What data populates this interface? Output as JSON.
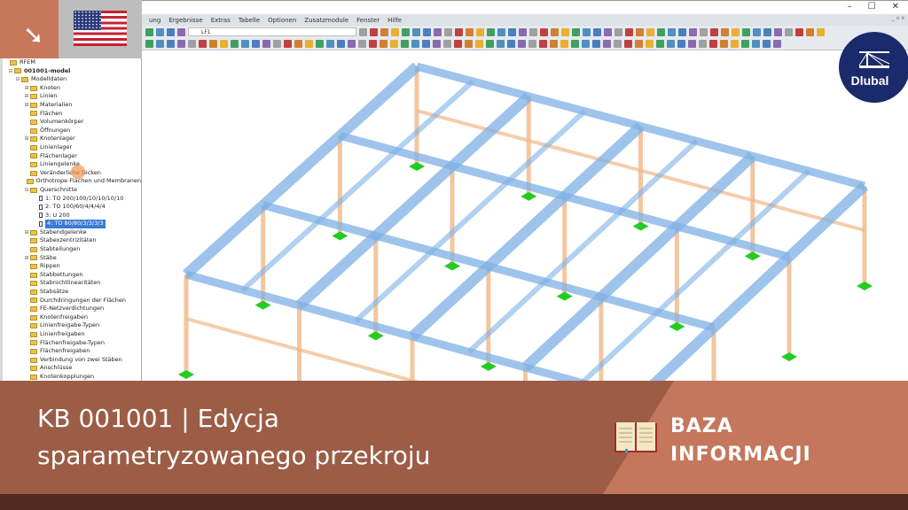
{
  "window": {
    "minimize": "–",
    "maximize": "☐",
    "close": "✕"
  },
  "menu": [
    "ung",
    "Ergebnisse",
    "Extras",
    "Tabelle",
    "Optionen",
    "Zusatzmodule",
    "Fenster",
    "Hilfe"
  ],
  "toolbar": {
    "load_case": "LF1"
  },
  "tree": {
    "root": "RFEM",
    "model": "001001-model",
    "group": "Modelldaten",
    "items": [
      {
        "label": "Knoten",
        "exp": true
      },
      {
        "label": "Linien",
        "exp": true
      },
      {
        "label": "Materialien",
        "exp": true
      },
      {
        "label": "Flächen"
      },
      {
        "label": "Volumenkörper"
      },
      {
        "label": "Öffnungen"
      },
      {
        "label": "Knotenlager",
        "exp": true
      },
      {
        "label": "Linienlager"
      },
      {
        "label": "Flächenlager"
      },
      {
        "label": "Liniengelenke"
      },
      {
        "label": "Veränderliche Dicken"
      },
      {
        "label": "Orthotrope Flächen und Membranen"
      },
      {
        "label": "Querschnitte",
        "exp": true,
        "open": true
      }
    ],
    "sections": [
      "1: TO 200/100/10/10/10/10",
      "2: TO 100/60/4/4/4/4",
      "3: U 200",
      "4: TO 80/80/3/3/3/3"
    ],
    "items2": [
      "Stabendgelenke",
      "Stabexzentrizitäten",
      "Stabteilungen",
      "Stäbe",
      "Rippen",
      "Stabbettungen",
      "Stabnichtlinearitäten",
      "Stabsätze",
      "Durchdringungen der Flächen",
      "FE-Netzverdichtungen",
      "Knotenfreigaben",
      "Linienfreigabe-Typen",
      "Linienfreigaben",
      "Flächenfreigabe-Typen",
      "Flächenfreigaben",
      "Verbindung von zwei Stäben",
      "Anschlüsse",
      "Knotenkopplungen"
    ]
  },
  "logo": {
    "text": "Dlubal"
  },
  "banner": {
    "title_line1": "KB 001001 | Edycja",
    "title_line2": "sparametryzowanego przekroju",
    "category_line1": "BAZA",
    "category_line2": "INFORMACJI"
  },
  "colors": {
    "beam": "#7fb0e6",
    "column": "#f0b888",
    "support": "#22cc22",
    "accent": "#c4775c"
  }
}
